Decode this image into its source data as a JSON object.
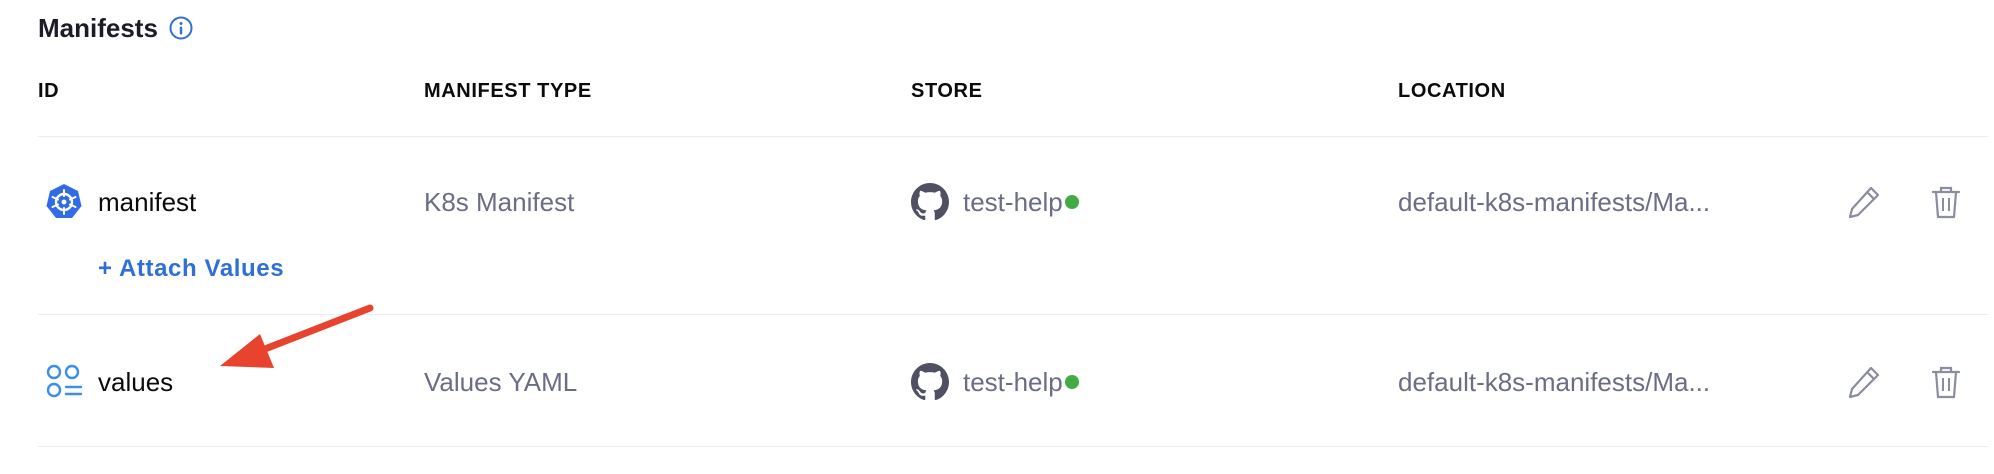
{
  "section": {
    "title": "Manifests"
  },
  "table": {
    "columns": [
      "ID",
      "MANIFEST TYPE",
      "STORE",
      "LOCATION"
    ],
    "rows": [
      {
        "id": "manifest",
        "type": "K8s Manifest",
        "store": "test-help",
        "location": "default-k8s-manifests/Ma...",
        "icon": "kubernetes-icon"
      },
      {
        "id": "values",
        "type": "Values YAML",
        "store": "test-help",
        "location": "default-k8s-manifests/Ma...",
        "icon": "values-icon"
      }
    ]
  },
  "attach": {
    "label": "+ Attach Values"
  },
  "colors": {
    "accent": "#2f6fd6",
    "status_ok": "#42ab45",
    "annotation_arrow": "#e8432e"
  }
}
